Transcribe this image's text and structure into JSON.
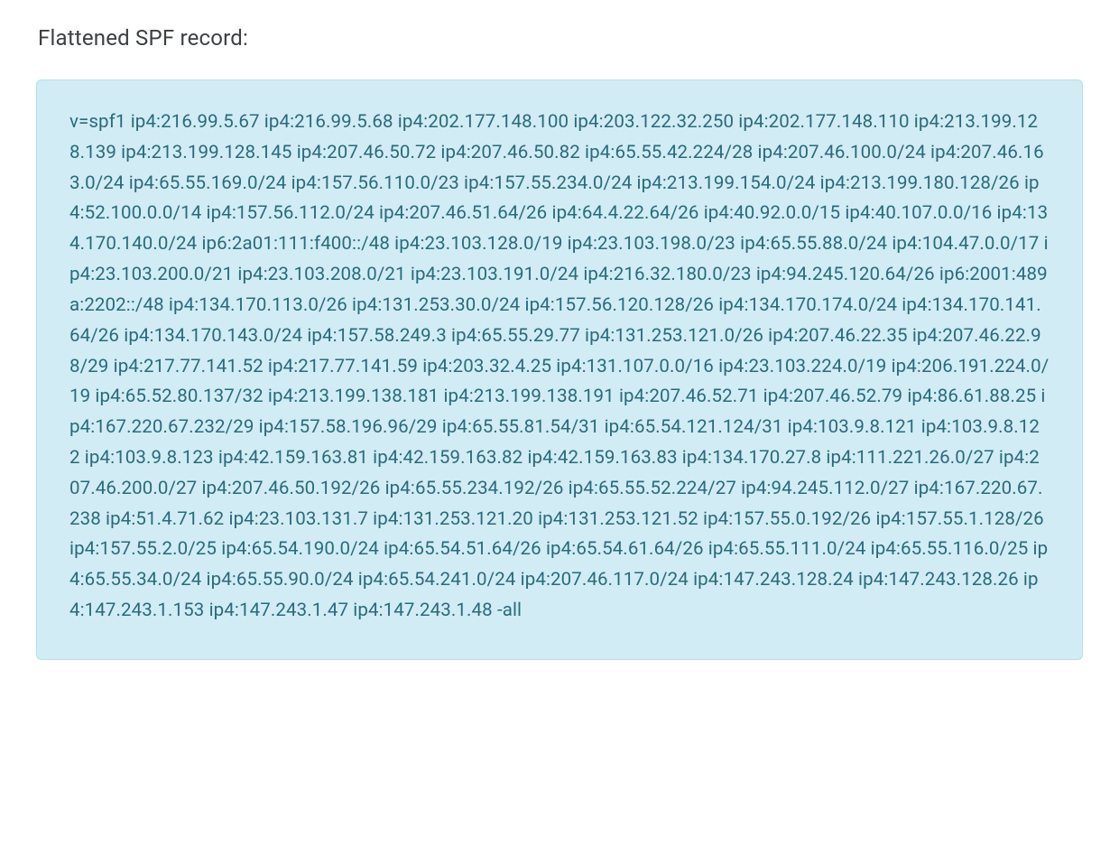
{
  "heading": "Flattened SPF record:",
  "spf_record": "v=spf1 ip4:216.99.5.67 ip4:216.99.5.68 ip4:202.177.148.100 ip4:203.122.32.250 ip4:202.177.148.110 ip4:213.199.128.139 ip4:213.199.128.145 ip4:207.46.50.72 ip4:207.46.50.82 ip4:65.55.42.224/28 ip4:207.46.100.0/24 ip4:207.46.163.0/24 ip4:65.55.169.0/24 ip4:157.56.110.0/23 ip4:157.55.234.0/24 ip4:213.199.154.0/24 ip4:213.199.180.128/26 ip4:52.100.0.0/14 ip4:157.56.112.0/24 ip4:207.46.51.64/26 ip4:64.4.22.64/26 ip4:40.92.0.0/15 ip4:40.107.0.0/16 ip4:134.170.140.0/24 ip6:2a01:111:f400::/48 ip4:23.103.128.0/19 ip4:23.103.198.0/23 ip4:65.55.88.0/24 ip4:104.47.0.0/17 ip4:23.103.200.0/21 ip4:23.103.208.0/21 ip4:23.103.191.0/24 ip4:216.32.180.0/23 ip4:94.245.120.64/26 ip6:2001:489a:2202::/48 ip4:134.170.113.0/26 ip4:131.253.30.0/24 ip4:157.56.120.128/26 ip4:134.170.174.0/24 ip4:134.170.141.64/26 ip4:134.170.143.0/24 ip4:157.58.249.3 ip4:65.55.29.77 ip4:131.253.121.0/26 ip4:207.46.22.35 ip4:207.46.22.98/29 ip4:217.77.141.52 ip4:217.77.141.59 ip4:203.32.4.25 ip4:131.107.0.0/16 ip4:23.103.224.0/19 ip4:206.191.224.0/19 ip4:65.52.80.137/32 ip4:213.199.138.181 ip4:213.199.138.191 ip4:207.46.52.71 ip4:207.46.52.79 ip4:86.61.88.25 ip4:167.220.67.232/29 ip4:157.58.196.96/29 ip4:65.55.81.54/31 ip4:65.54.121.124/31 ip4:103.9.8.121 ip4:103.9.8.122 ip4:103.9.8.123 ip4:42.159.163.81 ip4:42.159.163.82 ip4:42.159.163.83 ip4:134.170.27.8 ip4:111.221.26.0/27 ip4:207.46.200.0/27 ip4:207.46.50.192/26 ip4:65.55.234.192/26 ip4:65.55.52.224/27 ip4:94.245.112.0/27 ip4:167.220.67.238 ip4:51.4.71.62 ip4:23.103.131.7 ip4:131.253.121.20 ip4:131.253.121.52 ip4:157.55.0.192/26 ip4:157.55.1.128/26 ip4:157.55.2.0/25 ip4:65.54.190.0/24 ip4:65.54.51.64/26 ip4:65.54.61.64/26 ip4:65.55.111.0/24 ip4:65.55.116.0/25 ip4:65.55.34.0/24 ip4:65.55.90.0/24 ip4:65.54.241.0/24 ip4:207.46.117.0/24 ip4:147.243.128.24 ip4:147.243.128.26 ip4:147.243.1.153 ip4:147.243.1.47 ip4:147.243.1.48 -all",
  "colors": {
    "heading_text": "#3c4043",
    "box_bg": "#d1ecf4",
    "box_border": "#b7e0ec",
    "record_text": "#286b7d"
  }
}
